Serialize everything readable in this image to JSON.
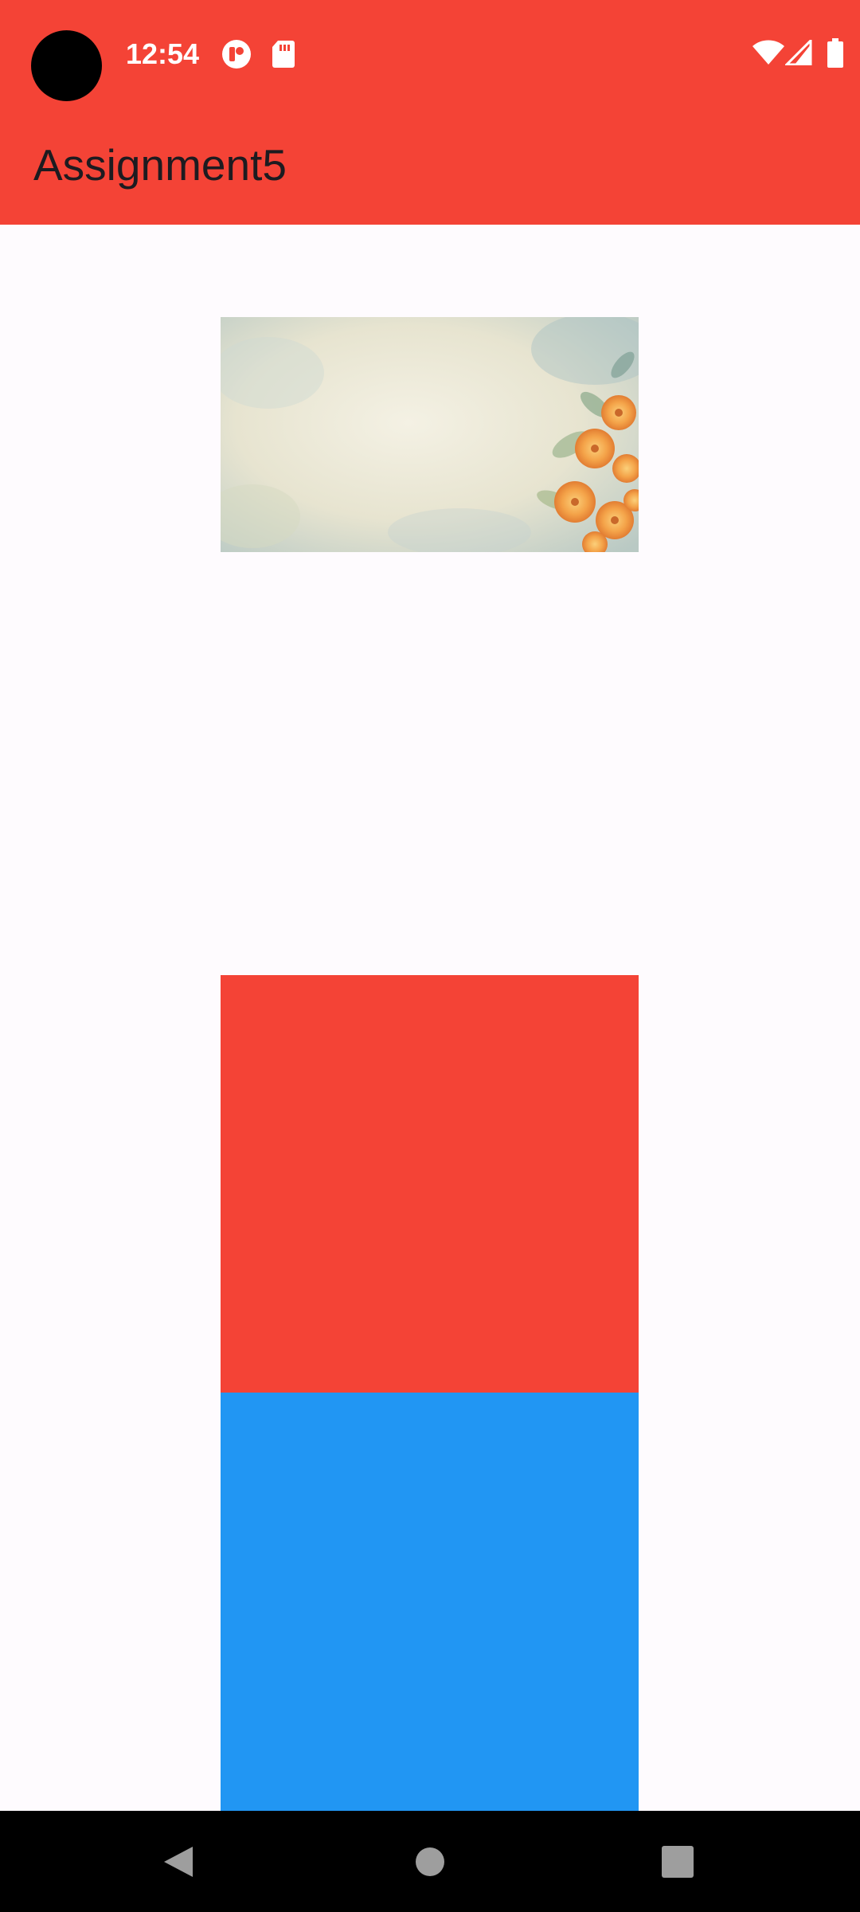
{
  "status_bar": {
    "time": "12:54",
    "icons": [
      "notification-app-icon",
      "sd-card-icon",
      "wifi-icon",
      "cellular-signal-icon",
      "battery-icon"
    ]
  },
  "app_bar": {
    "title": "Assignment5",
    "color": "#f44336"
  },
  "content": {
    "image": {
      "description_icon": "floral-background-image"
    },
    "boxes": [
      {
        "name": "red-box",
        "color": "#f44336"
      },
      {
        "name": "blue-box",
        "color": "#2196f3"
      }
    ]
  },
  "nav_bar": {
    "buttons": [
      "back-icon",
      "home-icon",
      "recents-icon"
    ]
  }
}
